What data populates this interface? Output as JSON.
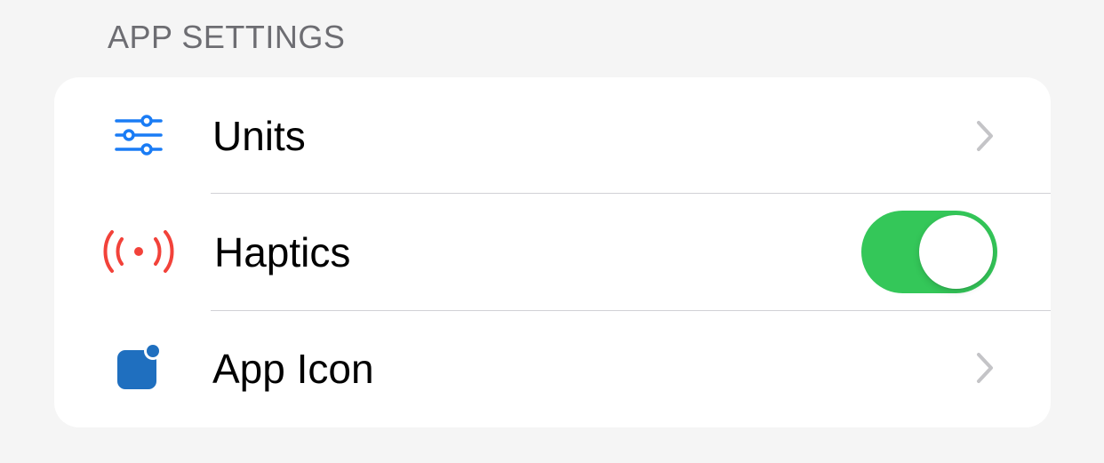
{
  "section": {
    "header": "APP SETTINGS"
  },
  "rows": [
    {
      "label": "Units",
      "icon": "sliders-icon",
      "accessory": "chevron"
    },
    {
      "label": "Haptics",
      "icon": "haptics-waves-icon",
      "accessory": "toggle",
      "toggle_on": true
    },
    {
      "label": "App Icon",
      "icon": "app-icon-badge-icon",
      "accessory": "chevron"
    }
  ],
  "colors": {
    "background": "#f5f5f5",
    "card": "#ffffff",
    "header_text": "#6d6d72",
    "units_icon": "#1a7cf5",
    "haptics_icon": "#f2423a",
    "app_icon": "#1f6fbf",
    "toggle_on": "#34c759",
    "chevron": "#c4c4c7",
    "divider": "#d1d1d6"
  }
}
